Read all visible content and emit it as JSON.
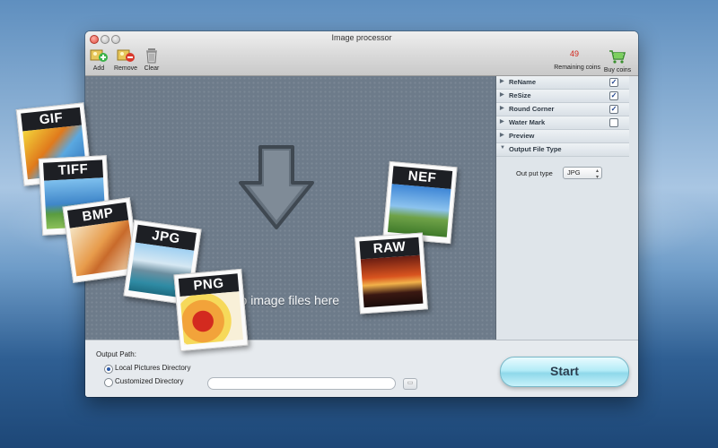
{
  "window": {
    "title": "Image processor"
  },
  "toolbar": {
    "add_label": "Add",
    "remove_label": "Remove",
    "clear_label": "Clear",
    "coins_count": "49",
    "coins_label": "Remaining coins",
    "buy_label": "Buy coins"
  },
  "drop_area": {
    "text": "Drop image files here"
  },
  "file_types": [
    "GIF",
    "TIFF",
    "BMP",
    "JPG",
    "PNG",
    "NEF",
    "RAW"
  ],
  "panel": {
    "rows": [
      {
        "label": "ReName",
        "checked": true
      },
      {
        "label": "ReSize",
        "checked": true
      },
      {
        "label": "Round Corner",
        "checked": true
      },
      {
        "label": "Water Mark",
        "checked": false
      },
      {
        "label": "Preview"
      },
      {
        "label": "Output File Type",
        "expanded": true
      }
    ],
    "output_type_label": "Out put type",
    "output_type_value": "JPG"
  },
  "bottom": {
    "output_path_label": "Output Path:",
    "local_dir_label": "Local Pictures Directory",
    "custom_dir_label": "Customized Directory",
    "path_value": "",
    "start_label": "Start"
  },
  "colors": {
    "accent_red": "#d2271c",
    "start_button": "#b4ecf7"
  }
}
